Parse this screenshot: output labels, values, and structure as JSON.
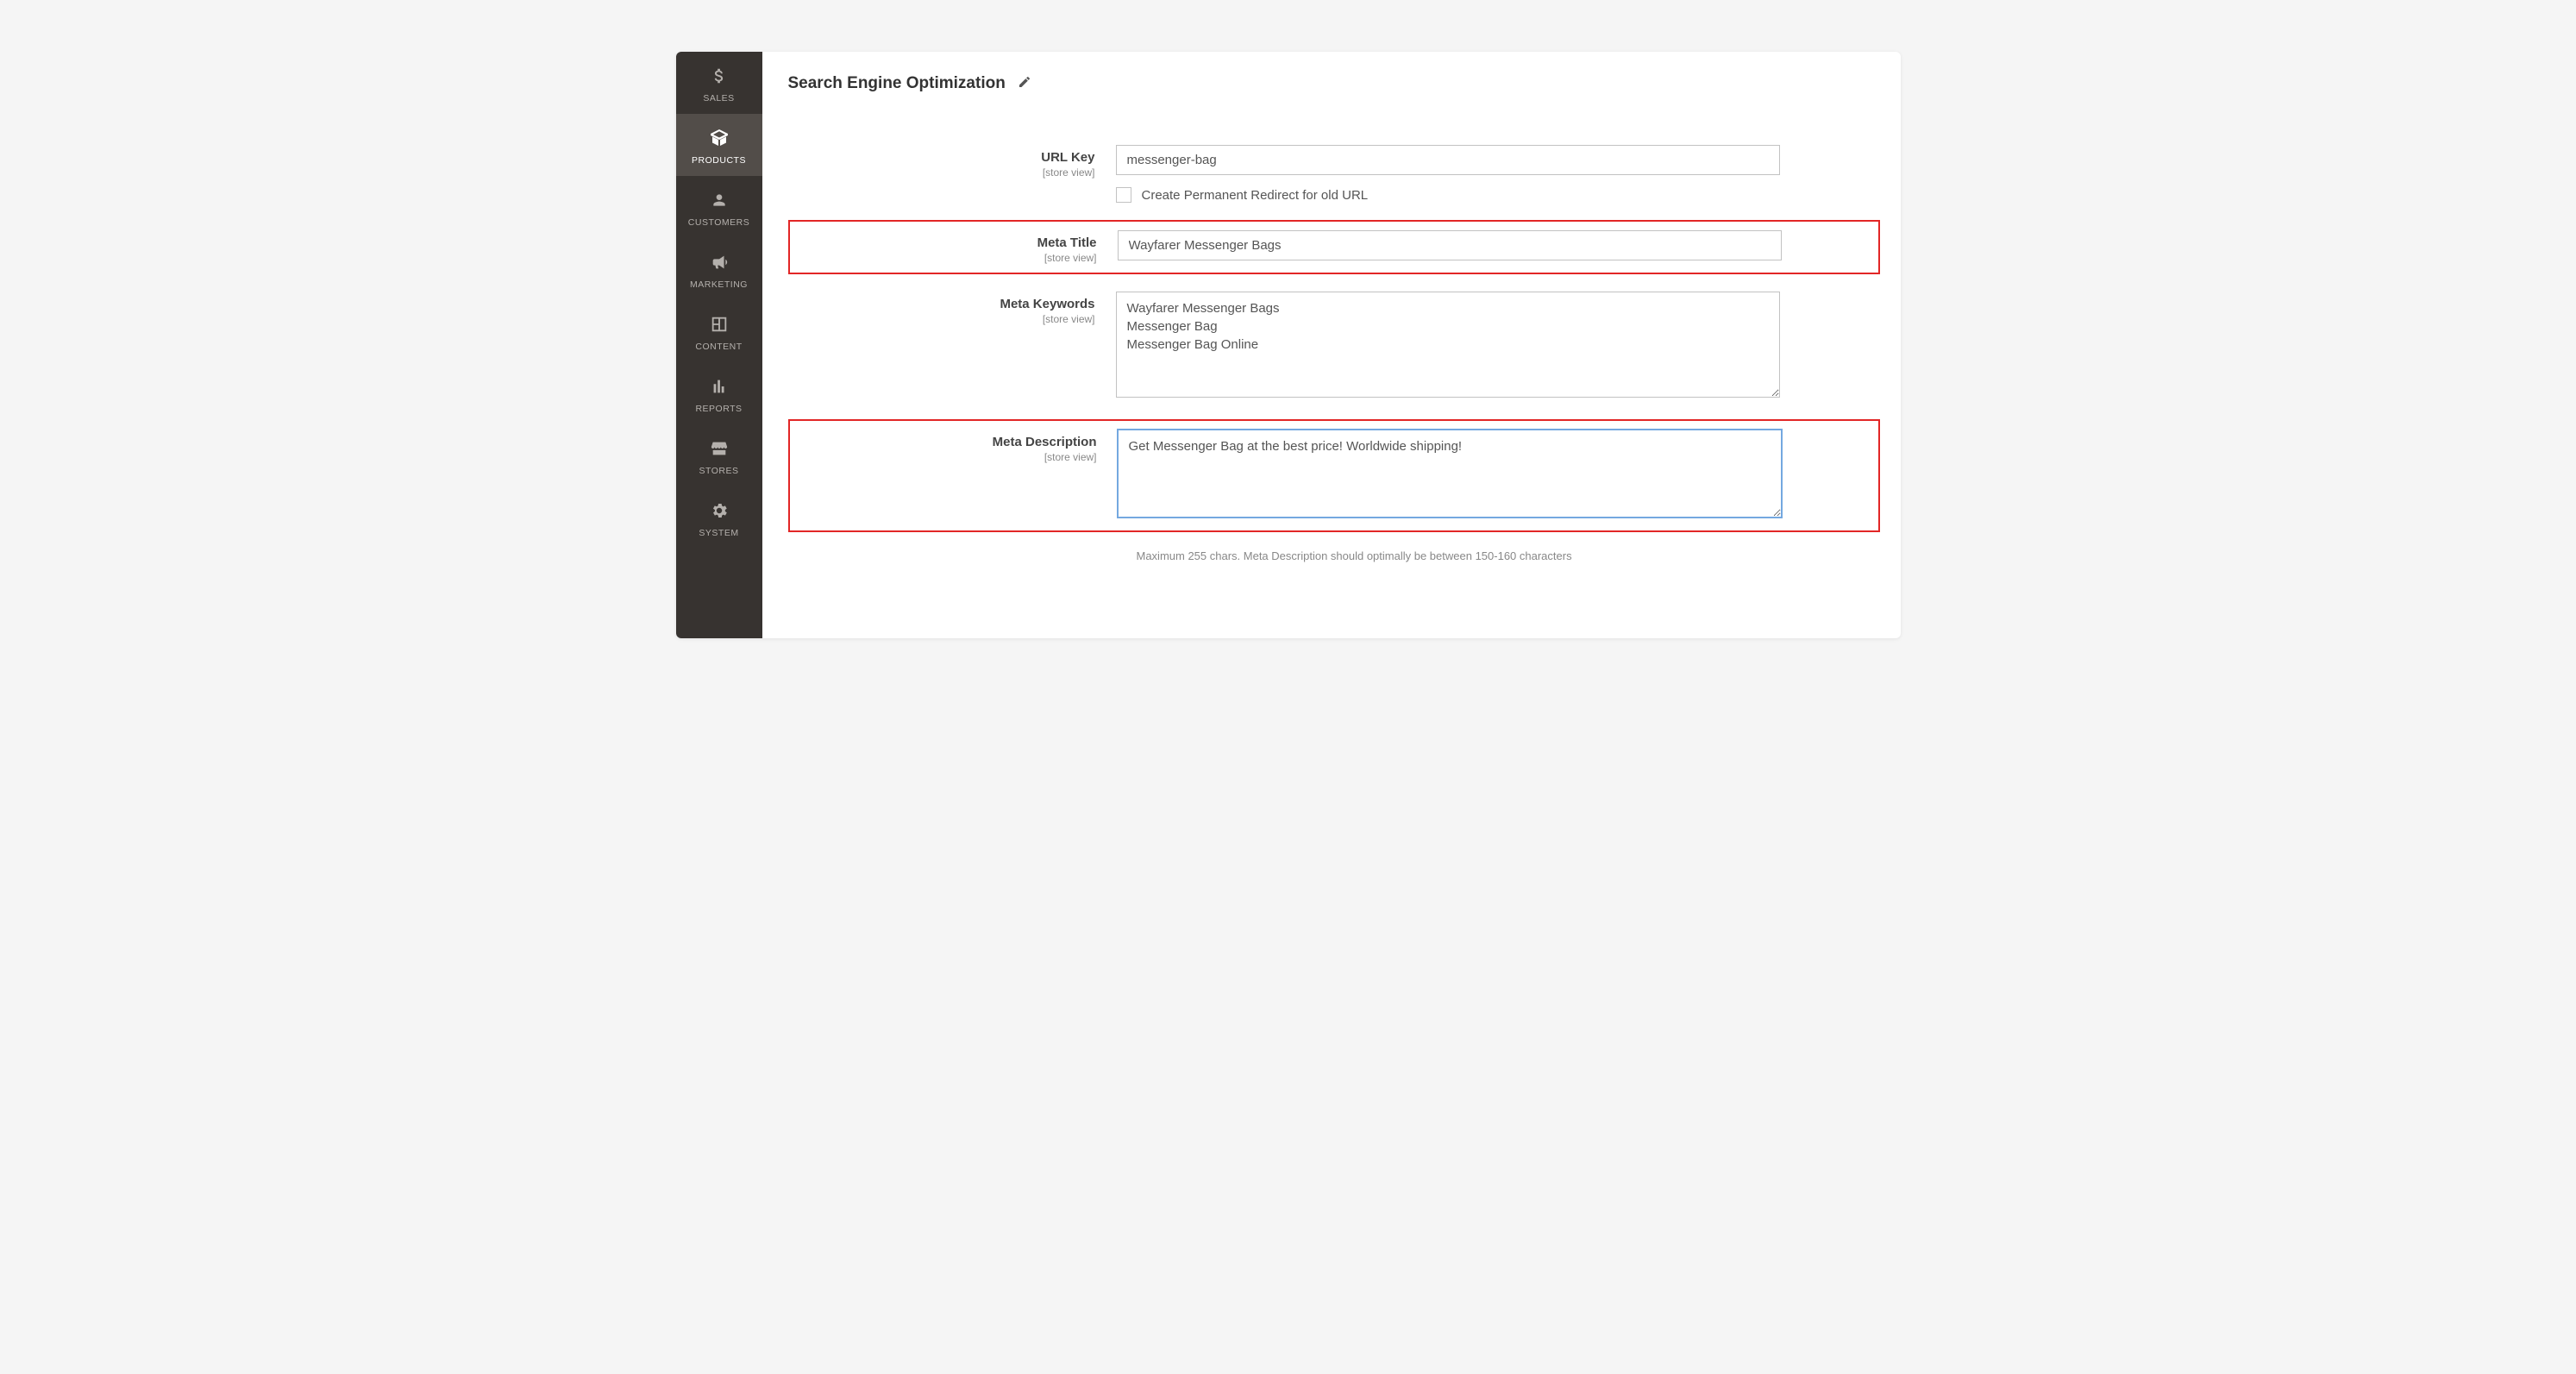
{
  "sidebar": {
    "items": [
      {
        "label": "SALES"
      },
      {
        "label": "PRODUCTS"
      },
      {
        "label": "CUSTOMERS"
      },
      {
        "label": "MARKETING"
      },
      {
        "label": "CONTENT"
      },
      {
        "label": "REPORTS"
      },
      {
        "label": "STORES"
      },
      {
        "label": "SYSTEM"
      }
    ]
  },
  "section": {
    "title": "Search Engine Optimization"
  },
  "fields": {
    "url_key": {
      "label": "URL Key",
      "scope": "[store view]",
      "value": "messenger-bag",
      "checkbox_label": "Create Permanent Redirect for old URL"
    },
    "meta_title": {
      "label": "Meta Title",
      "scope": "[store view]",
      "value": "Wayfarer Messenger Bags"
    },
    "meta_keywords": {
      "label": "Meta Keywords",
      "scope": "[store view]",
      "value": "Wayfarer Messenger Bags\nMessenger Bag\nMessenger Bag Online"
    },
    "meta_description": {
      "label": "Meta Description",
      "scope": "[store view]",
      "value": "Get Messenger Bag at the best price! Worldwide shipping!",
      "hint": "Maximum 255 chars. Meta Description should optimally be between 150-160 characters"
    }
  }
}
